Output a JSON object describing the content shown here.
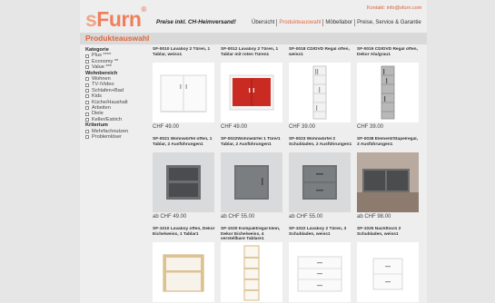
{
  "header": {
    "logo_s": "s",
    "logo_furn": "Furn",
    "logo_reg": "®",
    "tagline": "Preise inkl. CH-Heimversand!",
    "contact": "Kontakt: info@sfurn.com",
    "nav": [
      "Übersicht",
      "Produkteauswahl",
      "Möbellabor",
      "Preise, Service & Garantie"
    ],
    "active_nav": "Produkteauswahl"
  },
  "page_title": "Produkteauswahl",
  "sidebar": {
    "sections": [
      {
        "title": "Kategorie",
        "items": [
          "Plus ****",
          "Economy **",
          "Value ***"
        ]
      },
      {
        "title": "Wohnbereich",
        "items": [
          "Wohnen",
          "TV-/Video",
          "Schlafen+Bad",
          "Kids",
          "Küche/Haushalt",
          "Arbeiten",
          "Diele",
          "Keller/Estrich"
        ]
      },
      {
        "title": "Kriterium",
        "items": [
          "Mehrfachnutzen",
          "Problemlöser"
        ]
      }
    ]
  },
  "products": [
    {
      "name": "SF-0010 Lavaboy 2 Türen, 1 Tablar, weiss1",
      "price": "CHF 49.00",
      "icon": "white-cabinet-two-doors-icon"
    },
    {
      "name": "SF-0012 Lavaboy 2 Türen, 1 Tablar mit roten Türen1",
      "price": "CHF 49.00",
      "icon": "red-door-cabinet-icon"
    },
    {
      "name": "SF-0018 CD/DVD Regal offen, weiss1",
      "price": "CHF 39.00",
      "icon": "cd-shelf-white-icon"
    },
    {
      "name": "SF-0019 CD/DVD Regal offen, Dekor Alu/grau1",
      "price": "CHF 39.00",
      "icon": "cd-shelf-grey-icon"
    },
    {
      "name": "SF-0021 Wohnwürfel offen, 1 Tablar, 2 Ausführungen1",
      "price": "ab CHF 49.00",
      "icon": "open-cube-icon"
    },
    {
      "name": "SF-0022Wohnwürfel 1 Türe/1 Tablar, 2 Ausführungen1",
      "price": "ab CHF 55.00",
      "icon": "cube-door-icon"
    },
    {
      "name": "SF-0023 Wohnwürfel 2 Schubladen, 2 Ausführungen1",
      "price": "ab CHF 55.00",
      "icon": "cube-drawers-icon"
    },
    {
      "name": "SF-0038 Element/Stapelregal, 3 Ausführungen1",
      "price": "ab CHF 98.00",
      "icon": "stacking-shelf-icon"
    },
    {
      "name": "SF-1010 Lavaboy offen, Dekor Eiche/weiss, 1 Tablar1",
      "price": "",
      "icon": "oak-open-shelf-icon"
    },
    {
      "name": "SF-1020 Kompaktregal klein, Dekor Eiche/weiss, 4 verstellbare Tablare1",
      "price": "",
      "icon": "compact-shelf-icon"
    },
    {
      "name": "SF-1022 Lavaboy 2 Türen, 3 Schubladen, weiss1",
      "price": "",
      "icon": "white-drawer-cabinet-icon"
    },
    {
      "name": "SF-1025 Nachttisch 2 Schubladen, weiss1",
      "price": "",
      "icon": "white-nightstand-icon"
    }
  ]
}
